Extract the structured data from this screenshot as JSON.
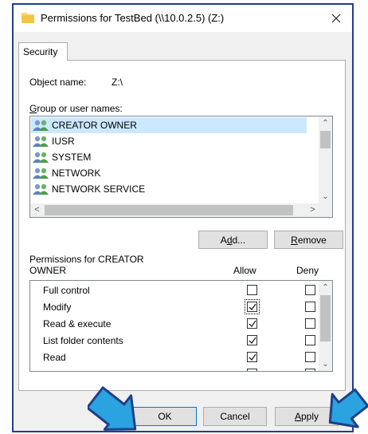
{
  "window": {
    "title": "Permissions for TestBed (\\\\10.0.2.5) (Z:)"
  },
  "tabs": [
    {
      "label": "Security"
    }
  ],
  "object": {
    "label": "Object name:",
    "value": "Z:\\"
  },
  "groups": {
    "label_ul": "G",
    "label_rest": "roup or user names:",
    "items": [
      {
        "name": "CREATOR OWNER",
        "selected": true
      },
      {
        "name": "IUSR",
        "selected": false
      },
      {
        "name": "SYSTEM",
        "selected": false
      },
      {
        "name": "NETWORK",
        "selected": false
      },
      {
        "name": "NETWORK SERVICE",
        "selected": false
      }
    ]
  },
  "buttons": {
    "add_pre": "A",
    "add_ul": "d",
    "add_post": "d...",
    "remove_ul": "R",
    "remove_post": "emove",
    "ok": "OK",
    "cancel": "Cancel",
    "apply_ul": "A",
    "apply_post": "pply"
  },
  "permissions": {
    "label": "Permissions for CREATOR OWNER",
    "allow_header": "Allow",
    "deny_header": "Deny",
    "items": [
      {
        "name": "Full control",
        "allow": false,
        "deny": false
      },
      {
        "name": "Modify",
        "allow": true,
        "deny": false
      },
      {
        "name": "Read & execute",
        "allow": true,
        "deny": false
      },
      {
        "name": "List folder contents",
        "allow": true,
        "deny": false
      },
      {
        "name": "Read",
        "allow": true,
        "deny": false
      }
    ]
  },
  "colors": {
    "accent": "#0078d7",
    "selection": "#cce8ff",
    "arrow": "#2aa3e0",
    "frame": "#1f3f8a"
  },
  "icons": [
    "folder-icon",
    "close-icon",
    "users-group-icon",
    "scroll-up-icon",
    "scroll-down-icon",
    "scroll-left-icon",
    "scroll-right-icon",
    "checkmark-icon",
    "pointer-arrow-icon"
  ]
}
